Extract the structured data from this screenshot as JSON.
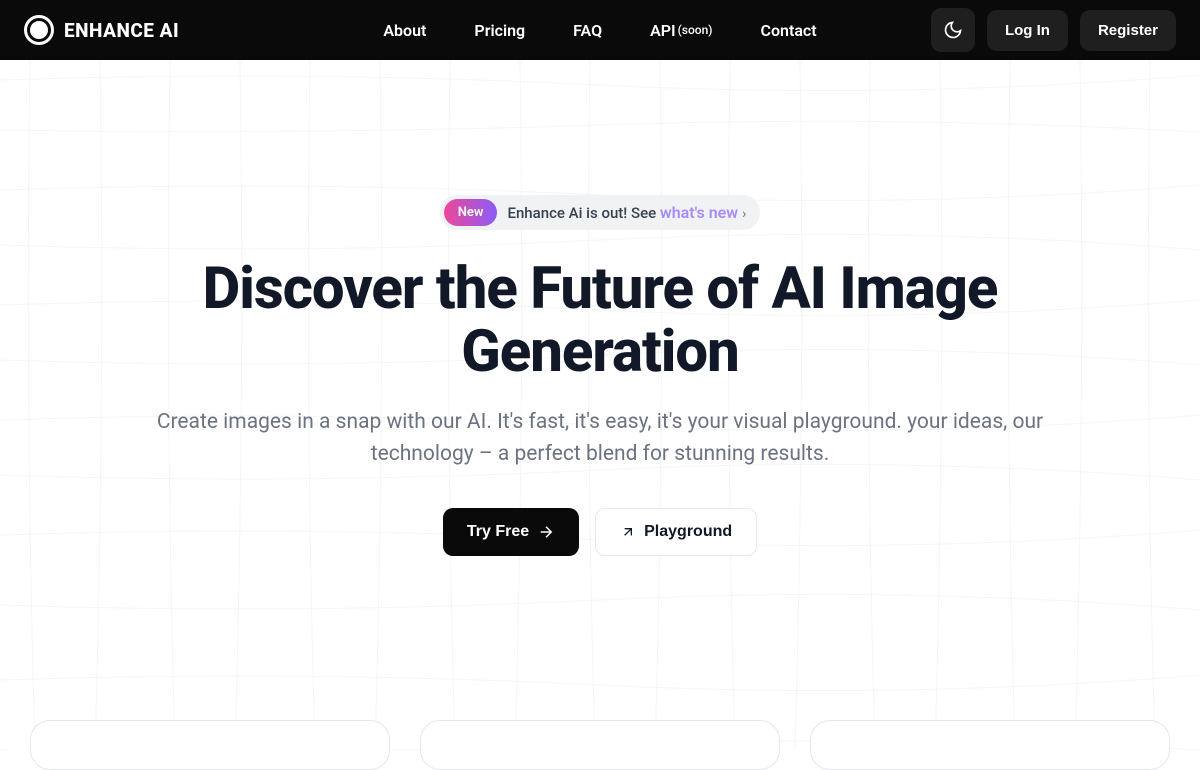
{
  "header": {
    "logo_text": "ENHANCE AI",
    "nav": [
      {
        "label": "About",
        "soon": ""
      },
      {
        "label": "Pricing",
        "soon": ""
      },
      {
        "label": "FAQ",
        "soon": ""
      },
      {
        "label": "API",
        "soon": "(soon)"
      },
      {
        "label": "Contact",
        "soon": ""
      }
    ],
    "login_label": "Log In",
    "register_label": "Register"
  },
  "hero": {
    "announcement": {
      "badge": "New",
      "text": "Enhance Ai is out! See ",
      "link": "what's new"
    },
    "title": "Discover the Future of AI Image Generation",
    "subtitle": "Create images in a snap with our AI. It's fast, it's easy, it's your visual playground. your ideas, our technology – a perfect blend for stunning results.",
    "cta_primary": "Try Free",
    "cta_secondary": "Playground"
  }
}
